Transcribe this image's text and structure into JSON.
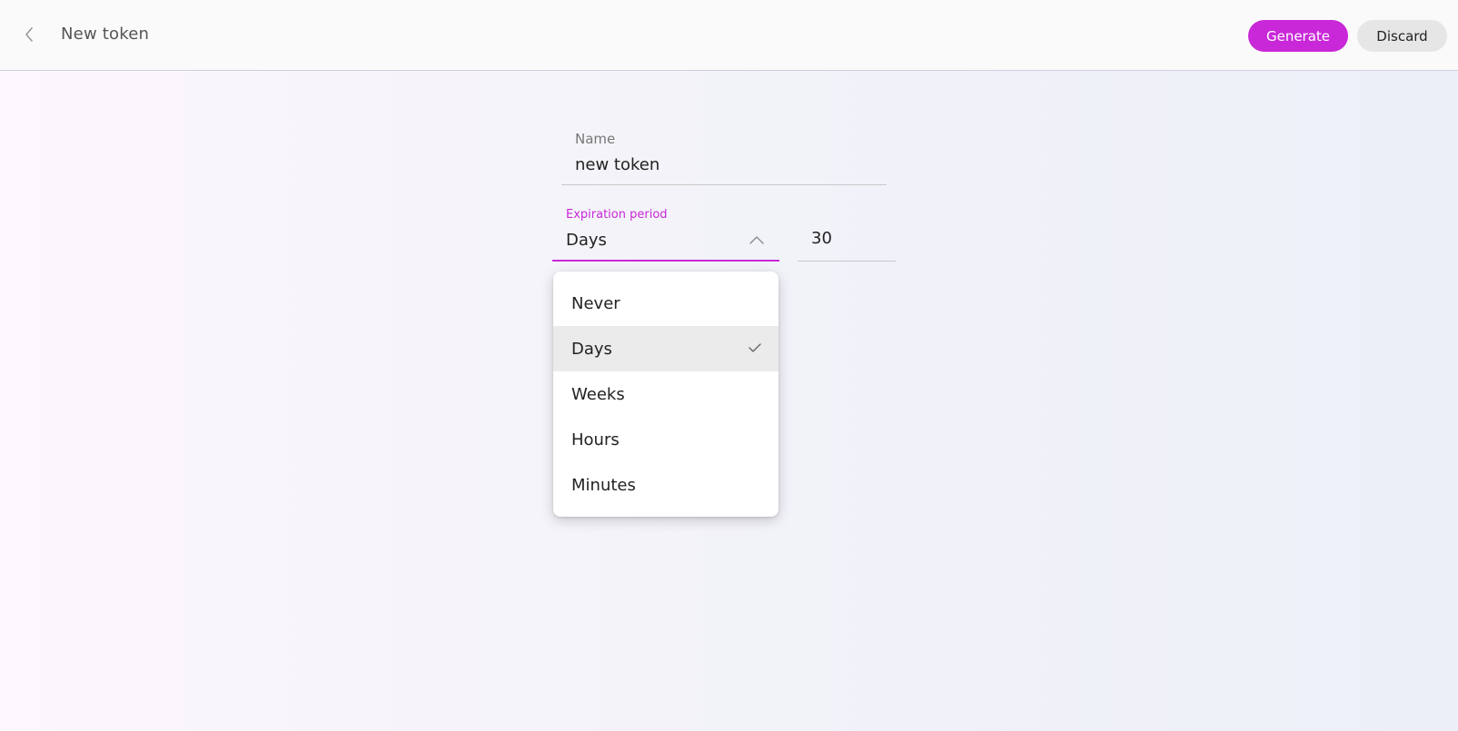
{
  "header": {
    "title": "New token",
    "generate_label": "Generate",
    "discard_label": "Discard"
  },
  "form": {
    "name_label": "Name",
    "name_value": "new token",
    "expiration_label": "Expiration period",
    "expiration_value": "Days",
    "amount_value": "30"
  },
  "dropdown": {
    "options": [
      "Never",
      "Days",
      "Weeks",
      "Hours",
      "Minutes"
    ],
    "selected": "Days"
  },
  "colors": {
    "accent": "#c928d8",
    "selected_option_bg": "#ebebeb"
  },
  "icons": {
    "back": "chevron-left-icon",
    "select_toggle": "chevron-up-icon",
    "selected_mark": "check-icon"
  }
}
